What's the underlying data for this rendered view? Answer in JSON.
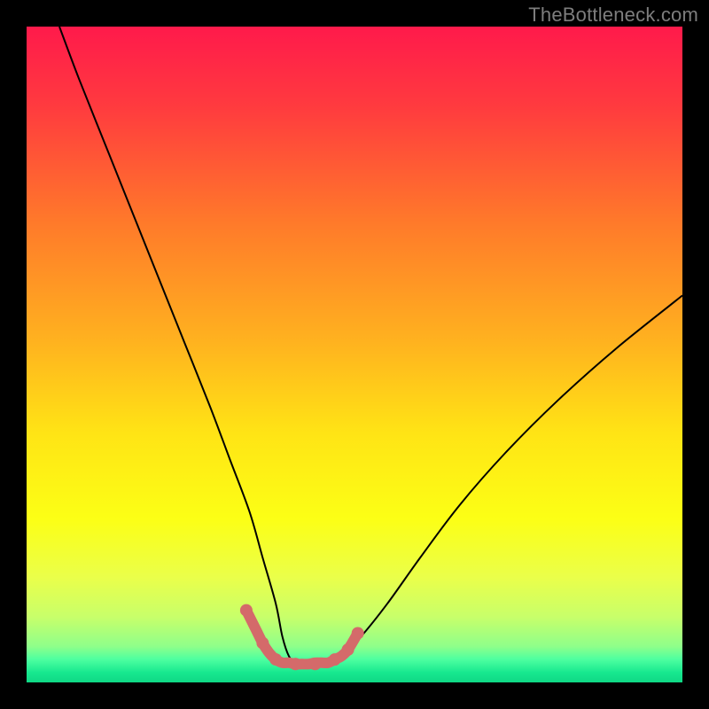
{
  "watermark": "TheBottleneck.com",
  "chart_data": {
    "type": "line",
    "title": "",
    "xlabel": "",
    "ylabel": "",
    "xlim": [
      0,
      100
    ],
    "ylim": [
      0,
      100
    ],
    "background_gradient": {
      "stops": [
        {
          "pos": 0.0,
          "color": "#ff1a4b"
        },
        {
          "pos": 0.12,
          "color": "#ff3a3f"
        },
        {
          "pos": 0.3,
          "color": "#ff7a2a"
        },
        {
          "pos": 0.48,
          "color": "#ffb21f"
        },
        {
          "pos": 0.62,
          "color": "#ffe415"
        },
        {
          "pos": 0.75,
          "color": "#fcff15"
        },
        {
          "pos": 0.84,
          "color": "#eaff4a"
        },
        {
          "pos": 0.9,
          "color": "#c8ff6a"
        },
        {
          "pos": 0.945,
          "color": "#8fff8a"
        },
        {
          "pos": 0.965,
          "color": "#4dffa0"
        },
        {
          "pos": 0.985,
          "color": "#17e88f"
        },
        {
          "pos": 1.0,
          "color": "#0fd885"
        }
      ]
    },
    "series": [
      {
        "name": "bottleneck-curve",
        "color": "#000000",
        "width": 2,
        "x": [
          5,
          8,
          12,
          16,
          20,
          24,
          28,
          31,
          34,
          36,
          38,
          39,
          40,
          41,
          42,
          45,
          48,
          51,
          55,
          60,
          66,
          73,
          81,
          90,
          100
        ],
        "values": [
          100,
          92,
          82,
          72,
          62,
          52,
          42,
          34,
          26,
          19,
          12,
          7,
          4,
          3,
          3,
          3,
          4,
          7,
          12,
          19,
          27,
          35,
          43,
          51,
          59
        ]
      },
      {
        "name": "optimal-range-highlight",
        "color": "#d46a6a",
        "width": 12,
        "linecap": "round",
        "x": [
          33.5,
          35,
          36,
          37,
          38,
          39,
          40,
          41,
          42,
          43,
          44,
          45,
          46,
          47,
          48,
          49,
          50.5
        ],
        "values": [
          11,
          8,
          6,
          4.5,
          3.5,
          3,
          3,
          2.8,
          2.8,
          2.8,
          3,
          3,
          3,
          3.5,
          4,
          5,
          7.5
        ]
      }
    ],
    "markers": {
      "name": "optimal-range-dots",
      "color": "#d46a6a",
      "radius": 7,
      "x": [
        33.5,
        36,
        38,
        41,
        44,
        47,
        49,
        50.5
      ],
      "values": [
        11,
        6,
        3.5,
        2.8,
        2.8,
        3.5,
        5,
        7.5
      ]
    }
  }
}
